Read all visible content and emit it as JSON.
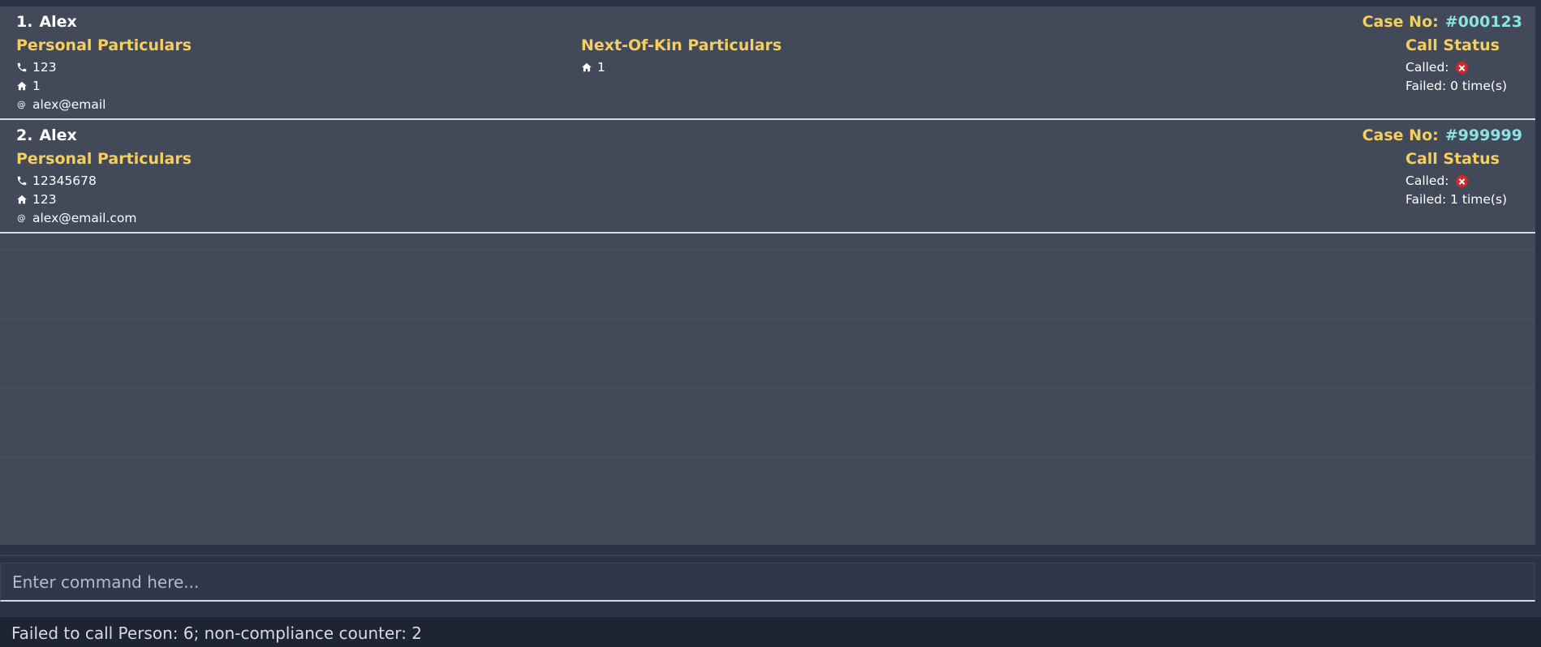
{
  "persons": [
    {
      "index": "1.",
      "name": "Alex",
      "case_label": "Case No:",
      "case_number": "#000123",
      "personal_title": "Personal Particulars",
      "phone": "123",
      "address": "1",
      "email": "alex@email",
      "nok_title": "Next-Of-Kin Particulars",
      "nok_address": "1",
      "call_status_title": "Call Status",
      "called_label": "Called:",
      "called_icon": "cross-circle-icon",
      "failed_text": "Failed: 0 time(s)"
    },
    {
      "index": "2.",
      "name": "Alex",
      "case_label": "Case No:",
      "case_number": "#999999",
      "personal_title": "Personal Particulars",
      "phone": "12345678",
      "address": "123",
      "email": "alex@email.com",
      "call_status_title": "Call Status",
      "called_label": "Called:",
      "called_icon": "cross-circle-icon",
      "failed_text": "Failed: 1 time(s)"
    }
  ],
  "command": {
    "value": "",
    "placeholder": "Enter command here..."
  },
  "result": {
    "message": "Failed to call Person: 6; non-compliance counter: 2"
  },
  "colors": {
    "background": "#424959",
    "section_title": "#f4cf5f",
    "case_number": "#8be3e3",
    "called_badge": "#d02828"
  }
}
